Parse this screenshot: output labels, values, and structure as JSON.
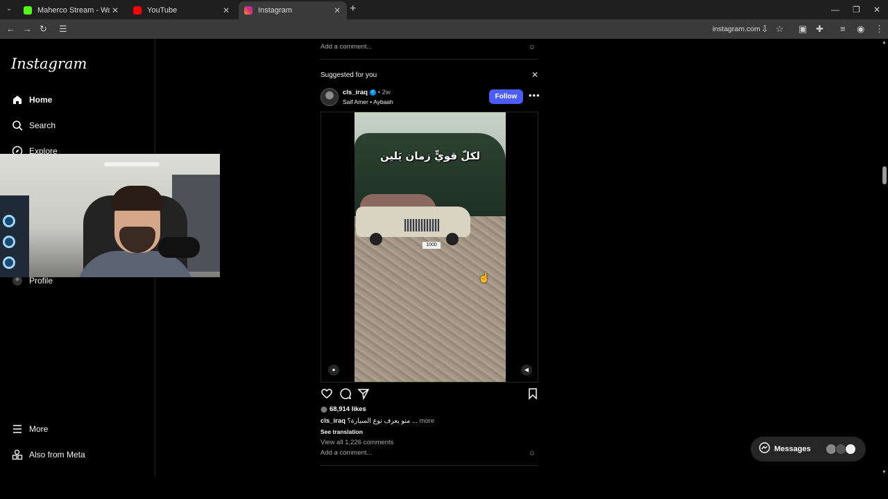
{
  "browser": {
    "tabs": [
      {
        "title": "Maherco Stream - Watch Live o",
        "favicon_color": "#53fc18",
        "active": false
      },
      {
        "title": "YouTube",
        "favicon_color": "#ff0000",
        "active": false
      },
      {
        "title": "Instagram",
        "favicon_color": "#e1306c",
        "active": true
      }
    ],
    "url": "instagram.com"
  },
  "sidebar": {
    "logo": "Instagram",
    "items": [
      {
        "label": "Home",
        "icon": "home-icon"
      },
      {
        "label": "Search",
        "icon": "search-icon"
      },
      {
        "label": "Explore",
        "icon": "compass-icon"
      },
      {
        "label": "Profile",
        "icon": "avatar-icon"
      },
      {
        "label": "More",
        "icon": "menu-icon"
      },
      {
        "label": "Also from Meta",
        "icon": "meta-apps-icon"
      }
    ]
  },
  "feed": {
    "prev_post": {
      "add_comment_placeholder": "Add a comment..."
    },
    "suggested_label": "Suggested for you",
    "post": {
      "username": "cls_iraq",
      "time": "2w",
      "music": "Saif Amer • Aybaah",
      "follow_label": "Follow",
      "overlay_text": "لكلّ قويٍّ زمان يَلين",
      "plate": "1000",
      "likes": "68,914 likes",
      "caption_user": "cls_iraq",
      "caption_text": "منو يعرف نوع السيارة؟ ...",
      "caption_more": "more",
      "see_translation": "See translation",
      "view_all_comments": "View all 1,226 comments",
      "add_comment_placeholder": "Add a comment..."
    }
  },
  "messages": {
    "label": "Messages"
  }
}
